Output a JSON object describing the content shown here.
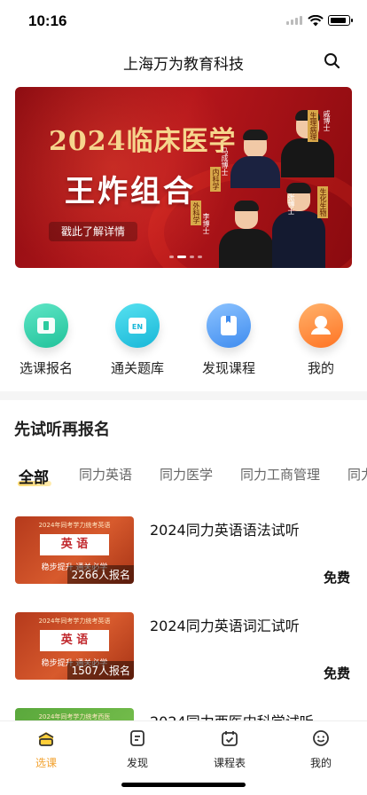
{
  "status_bar": {
    "time": "10:16"
  },
  "header": {
    "title": "上海万为教育科技",
    "search_icon": "search-icon"
  },
  "banner": {
    "headline": "2024临床医学",
    "slogan": "王炸组合",
    "cta": "戳此了解详情",
    "teacher_tags": [
      "生理病理",
      "戚博士",
      "内科学",
      "马成博士",
      "生化生物",
      "张博士",
      "外科学",
      "李博士"
    ],
    "accent": "#b5161b"
  },
  "quick_nav": [
    {
      "label": "选课报名",
      "icon": "book-open-icon",
      "color": "#3ad6b0"
    },
    {
      "label": "通关题库",
      "icon": "question-bank-icon",
      "color": "#2cc6e0"
    },
    {
      "label": "发现课程",
      "icon": "bookmark-book-icon",
      "color": "#5aa2f4"
    },
    {
      "label": "我的",
      "icon": "user-icon",
      "color": "#ff8a3d"
    }
  ],
  "section": {
    "title": "先试听再报名"
  },
  "category_tabs": [
    "全部",
    "同力英语",
    "同力医学",
    "同力工商管理",
    "同力"
  ],
  "courses": [
    {
      "name": "2024同力英语语法试听",
      "price": "免费",
      "enrolled": "2266人报名",
      "thumb_top": "2024年同考学力统考英语",
      "thumb_box": "英 语",
      "thumb_sub": "稳步提升 通关必学"
    },
    {
      "name": "2024同力英语词汇试听",
      "price": "免费",
      "enrolled": "1507人报名",
      "thumb_top": "2024年同考学力统考英语",
      "thumb_box": "英 语",
      "thumb_sub": "稳步提升 通关必学"
    },
    {
      "name": "2024同力西医内科学试听",
      "thumb_top": "2024年同考学力统考西医"
    }
  ],
  "tabbar": [
    {
      "label": "选课",
      "icon": "course-select-icon",
      "active": true
    },
    {
      "label": "发现",
      "icon": "discover-icon"
    },
    {
      "label": "课程表",
      "icon": "calendar-check-icon"
    },
    {
      "label": "我的",
      "icon": "smiley-user-icon"
    }
  ],
  "colors": {
    "active_tab": "#f2a12e",
    "tab_underline": "#ffd86b"
  }
}
